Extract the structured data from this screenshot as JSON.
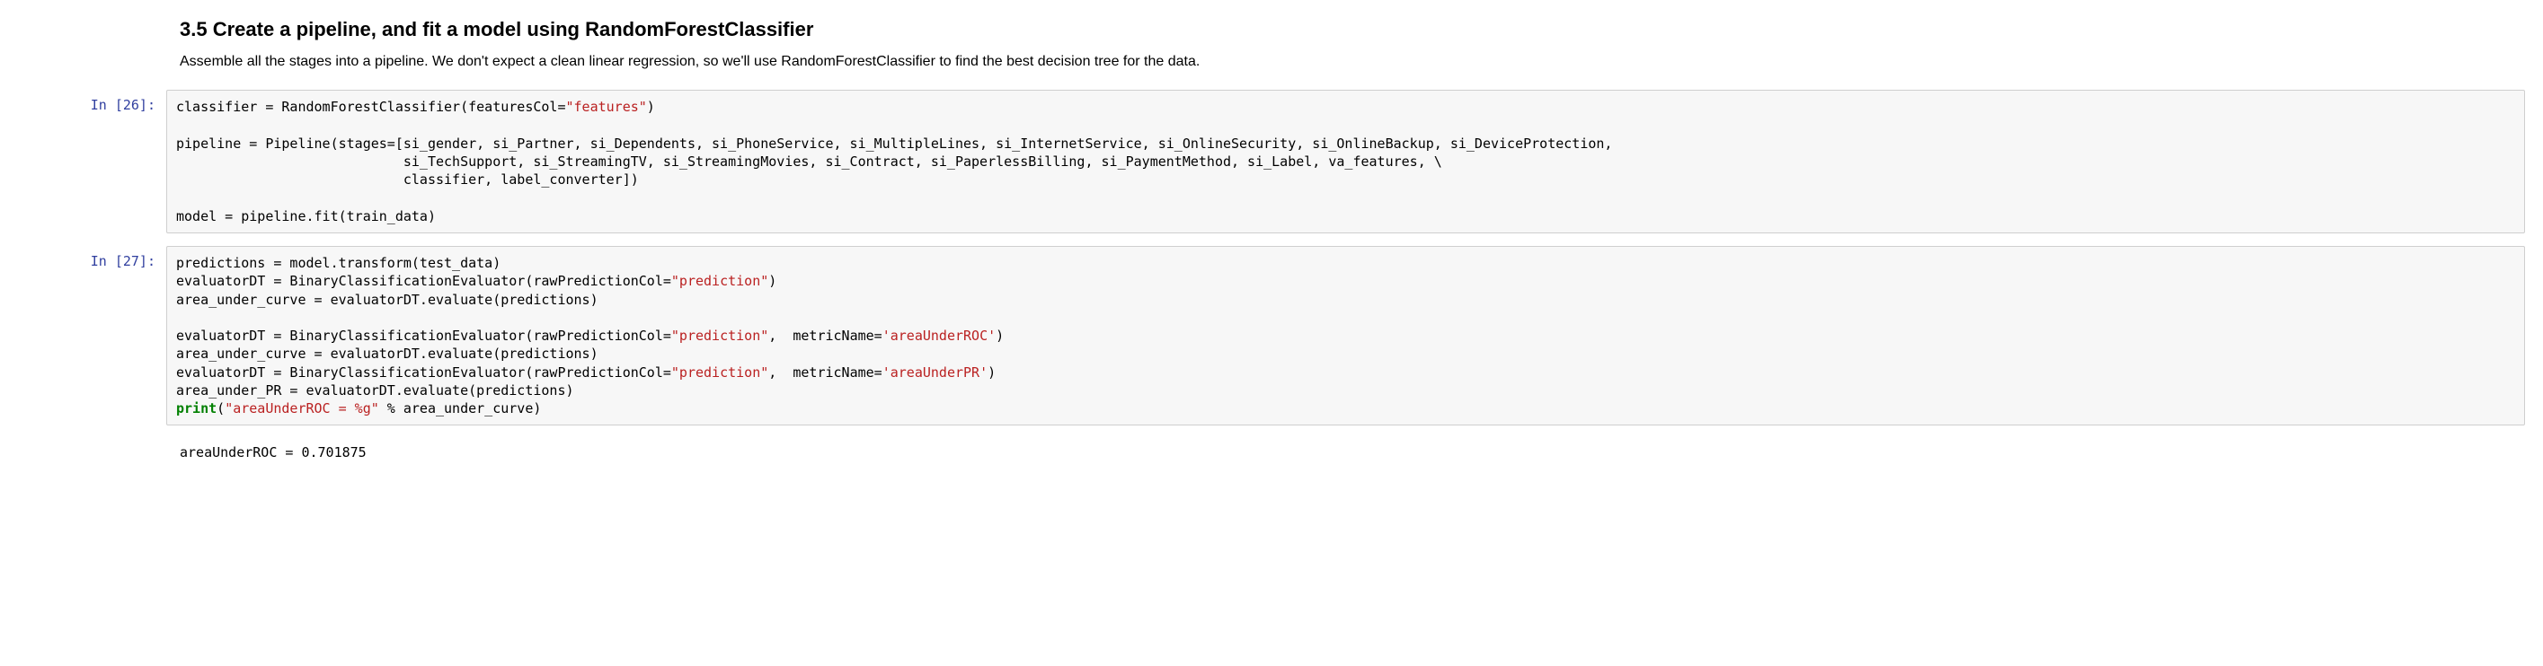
{
  "markdown": {
    "heading": "3.5 Create a pipeline, and fit a model using RandomForestClassifier",
    "body": "Assemble all the stages into a pipeline. We don't expect a clean linear regression, so we'll use RandomForestClassifier to find the best decision tree for the data."
  },
  "cells": [
    {
      "prompt": "In [26]:",
      "code": {
        "l1a": "classifier = RandomForestClassifier(featuresCol=",
        "l1s": "\"features\"",
        "l1b": ")",
        "blank1": "",
        "l2": "pipeline = Pipeline(stages=[si_gender, si_Partner, si_Dependents, si_PhoneService, si_MultipleLines, si_InternetService, si_OnlineSecurity, si_OnlineBackup, si_DeviceProtection,",
        "l3": "                            si_TechSupport, si_StreamingTV, si_StreamingMovies, si_Contract, si_PaperlessBilling, si_PaymentMethod, si_Label, va_features, \\",
        "l4": "                            classifier, label_converter])",
        "blank2": "",
        "l5": "model = pipeline.fit(train_data)"
      }
    },
    {
      "prompt": "In [27]:",
      "code": {
        "l1": "predictions = model.transform(test_data)",
        "l2a": "evaluatorDT = BinaryClassificationEvaluator(rawPredictionCol=",
        "l2s": "\"prediction\"",
        "l2b": ")",
        "l3": "area_under_curve = evaluatorDT.evaluate(predictions)",
        "blank1": "",
        "l4a": "evaluatorDT = BinaryClassificationEvaluator(rawPredictionCol=",
        "l4s1": "\"prediction\"",
        "l4b": ",  metricName=",
        "l4s2": "'areaUnderROC'",
        "l4c": ")",
        "l5": "area_under_curve = evaluatorDT.evaluate(predictions)",
        "l6a": "evaluatorDT = BinaryClassificationEvaluator(rawPredictionCol=",
        "l6s1": "\"prediction\"",
        "l6b": ",  metricName=",
        "l6s2": "'areaUnderPR'",
        "l6c": ")",
        "l7": "area_under_PR = evaluatorDT.evaluate(predictions)",
        "l8kw": "print",
        "l8a": "(",
        "l8s": "\"areaUnderROC = %g\"",
        "l8b": " % area_under_curve)"
      },
      "output": "areaUnderROC = 0.701875"
    }
  ]
}
